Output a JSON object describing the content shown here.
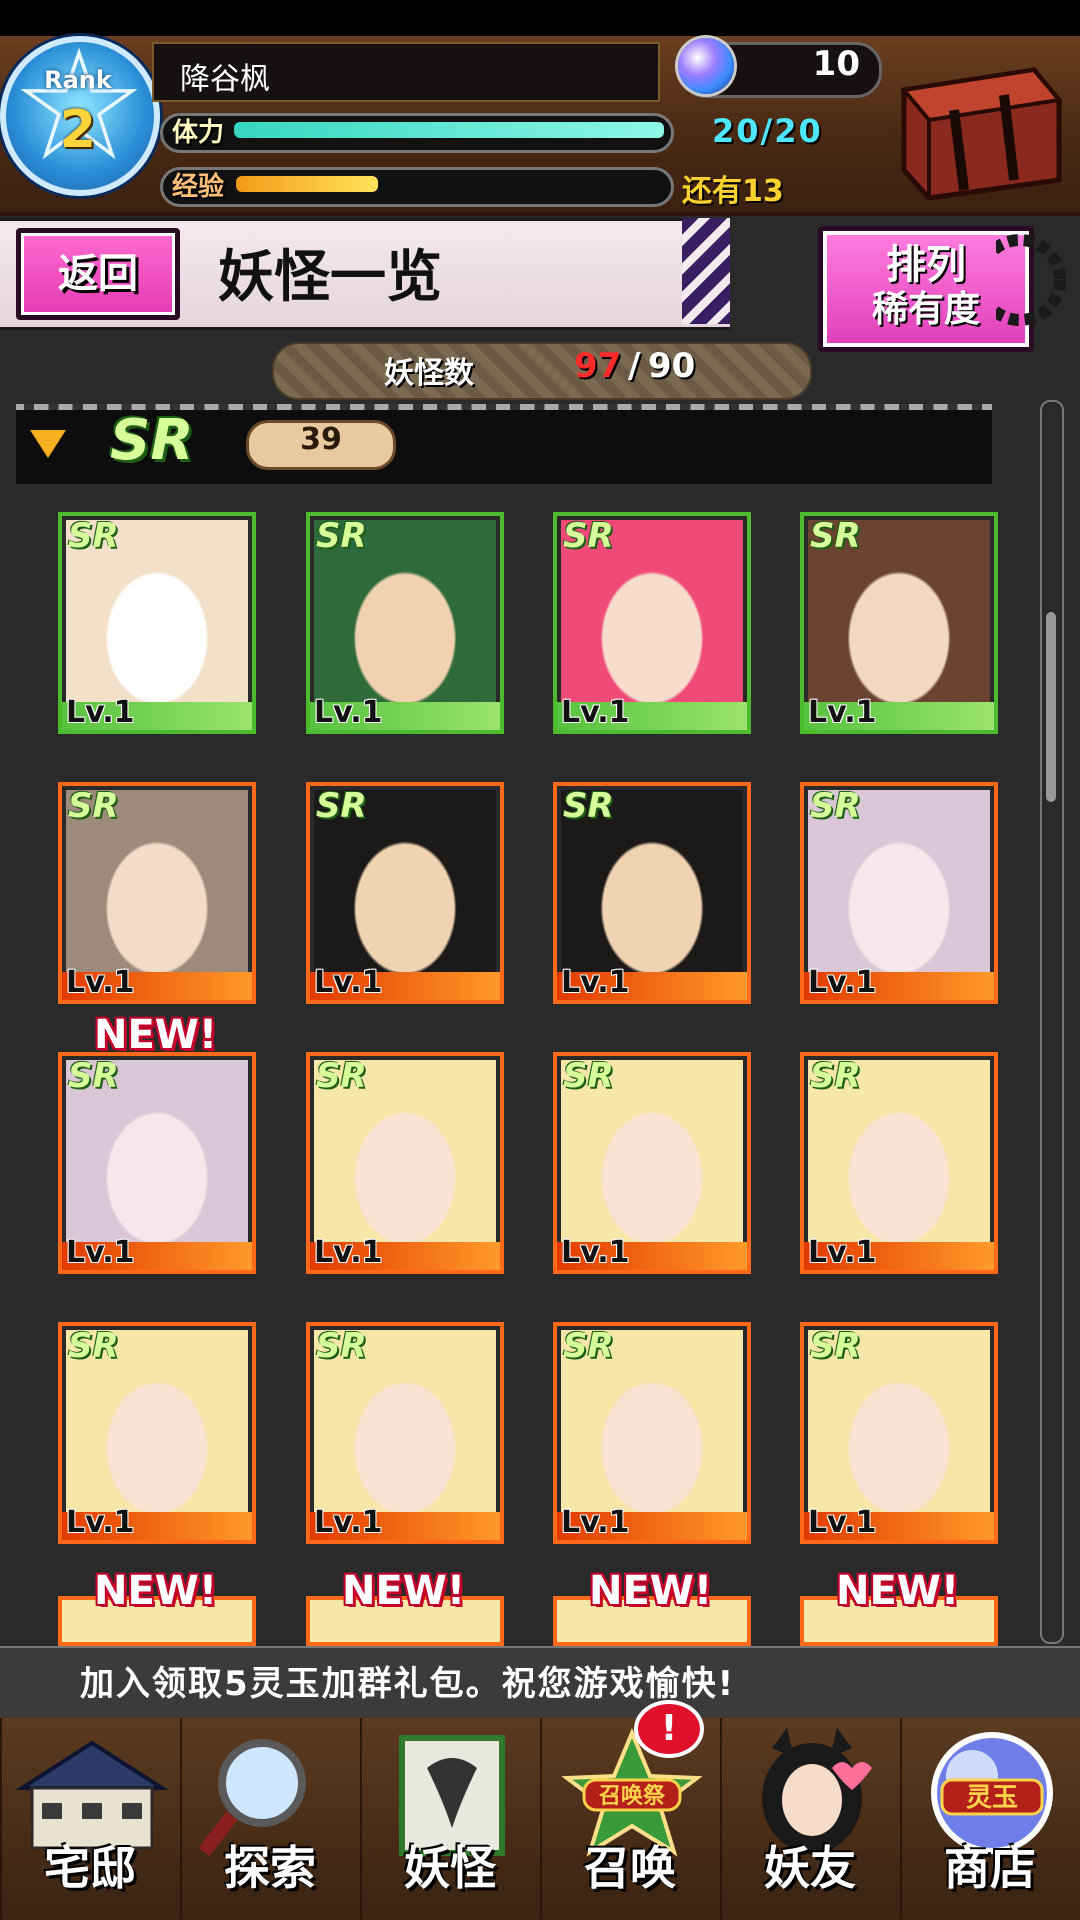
{
  "header": {
    "rank_label": "Rank",
    "rank_value": "2",
    "player_name": "降谷枫",
    "stamina_label": "体力",
    "stamina_value": "20/20",
    "stamina_fraction": 1.0,
    "exp_label": "经验",
    "exp_remaining": "还有13",
    "exp_fraction": 0.33,
    "gem_count": "10"
  },
  "title_bar": {
    "back_label": "返回",
    "title": "妖怪一览",
    "sort_title": "排列",
    "sort_value": "稀有度"
  },
  "monster_count": {
    "label": "妖怪数",
    "current": "97",
    "separator": "/",
    "max": "90"
  },
  "section": {
    "rarity": "SR",
    "count": "39"
  },
  "cards": [
    {
      "rarity": "SR",
      "level": "Lv.1",
      "frame": "green",
      "new": false
    },
    {
      "rarity": "SR",
      "level": "Lv.1",
      "frame": "green",
      "new": false
    },
    {
      "rarity": "SR",
      "level": "Lv.1",
      "frame": "green",
      "new": false
    },
    {
      "rarity": "SR",
      "level": "Lv.1",
      "frame": "green",
      "new": false
    },
    {
      "rarity": "SR",
      "level": "Lv.1",
      "frame": "orange",
      "new": false
    },
    {
      "rarity": "SR",
      "level": "Lv.1",
      "frame": "orange",
      "new": false
    },
    {
      "rarity": "SR",
      "level": "Lv.1",
      "frame": "orange",
      "new": false
    },
    {
      "rarity": "SR",
      "level": "Lv.1",
      "frame": "orange",
      "new": false
    },
    {
      "rarity": "SR",
      "level": "Lv.1",
      "frame": "orange",
      "new": true
    },
    {
      "rarity": "SR",
      "level": "Lv.1",
      "frame": "orange",
      "new": false
    },
    {
      "rarity": "SR",
      "level": "Lv.1",
      "frame": "orange",
      "new": false
    },
    {
      "rarity": "SR",
      "level": "Lv.1",
      "frame": "orange",
      "new": false
    },
    {
      "rarity": "SR",
      "level": "Lv.1",
      "frame": "orange",
      "new": false
    },
    {
      "rarity": "SR",
      "level": "Lv.1",
      "frame": "orange",
      "new": false
    },
    {
      "rarity": "SR",
      "level": "Lv.1",
      "frame": "orange",
      "new": false
    },
    {
      "rarity": "SR",
      "level": "Lv.1",
      "frame": "orange",
      "new": false
    }
  ],
  "partial_row_new_label": "NEW!",
  "ticker": "加入领取5灵玉加群礼包。祝您游戏愉快!",
  "nav": [
    {
      "label": "宅邸",
      "icon": "mansion-icon"
    },
    {
      "label": "探索",
      "icon": "magnifier-icon"
    },
    {
      "label": "妖怪",
      "icon": "scroll-icon"
    },
    {
      "label": "召唤",
      "icon": "summon-star-icon",
      "badge_text": "召唤祭"
    },
    {
      "label": "妖友",
      "icon": "fox-girl-icon"
    },
    {
      "label": "商店",
      "icon": "spirit-orb-icon",
      "badge_text": "灵玉"
    }
  ],
  "summon_alert": "!",
  "colors": {
    "frame_green": "#4cbb2e",
    "frame_orange": "#ff6a1a",
    "accent_pink": "#e23bb2",
    "stamina": "#4de8ff",
    "exp": "#ffd12e",
    "count_over": "#ff2b2b"
  }
}
